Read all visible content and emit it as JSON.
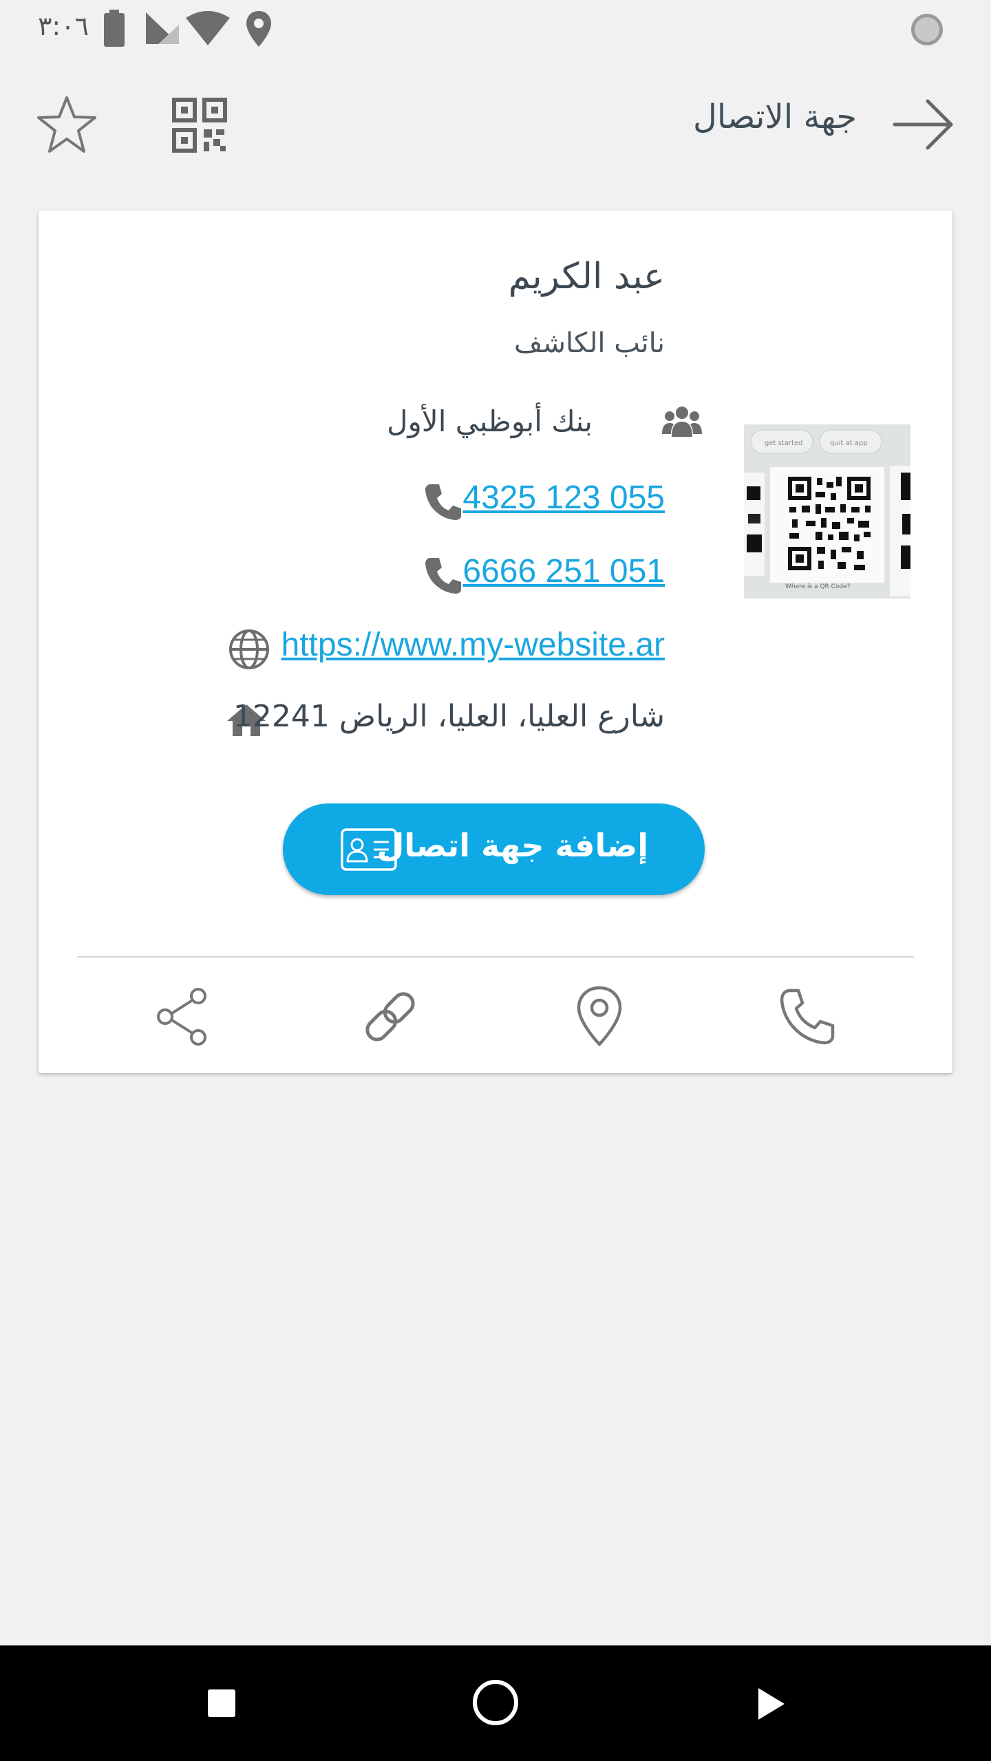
{
  "status_bar": {
    "time": "٣:٠٦",
    "icons": [
      "battery-icon",
      "signal-icon",
      "wifi-icon",
      "location-icon",
      "loading-indicator-icon"
    ]
  },
  "header": {
    "title": "جهة الاتصال",
    "back_icon": "arrow-right-icon",
    "qr_icon": "qr-code-icon",
    "favorite_icon": "star-icon"
  },
  "contact": {
    "name": "عبد الكريم",
    "title": "نائب الكاشف",
    "company": "بنك أبوظبي الأول",
    "phones": [
      "4325 123 055",
      "6666 251 051"
    ],
    "website": "https://www.my-website.ar",
    "address": "شارع العليا، العليا، الرياض 12241",
    "qr_thumbnail_text": [
      "get started",
      "quit at app",
      "Where is a QR Code?"
    ]
  },
  "actions": {
    "add_contact_label": "إضافة جهة اتصال",
    "bottom_icons": [
      "share-icon",
      "link-icon",
      "location-pin-icon",
      "phone-icon"
    ]
  },
  "nav_bar": {
    "icons": [
      "recents-icon",
      "home-icon",
      "back-icon"
    ]
  },
  "colors": {
    "accent": "#0fa9e6",
    "link": "#1aa6e0",
    "background": "#f1f1f1",
    "card": "#ffffff",
    "text": "#3c4852",
    "icon": "#6d6d6d"
  }
}
